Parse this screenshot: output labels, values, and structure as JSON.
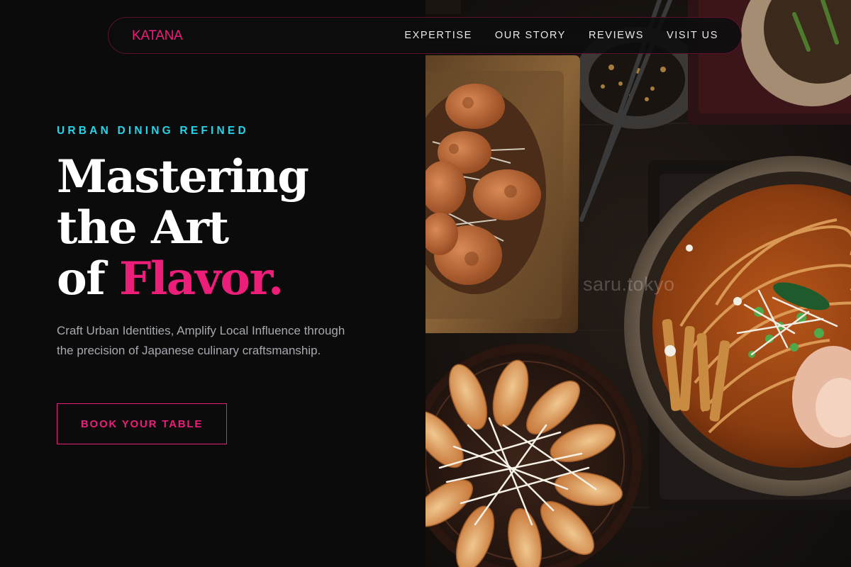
{
  "brand": {
    "name": "KATANA",
    "accent_color": "#ec1e79",
    "highlight_color": "#29d3e8"
  },
  "nav": {
    "links": [
      "EXPERTISE",
      "OUR STORY",
      "REVIEWS",
      "VISIT US"
    ]
  },
  "hero": {
    "eyebrow": "URBAN DINING REFINED",
    "headline_line1": "Mastering",
    "headline_line2": "the Art",
    "headline_line3_prefix": "of ",
    "headline_line3_accent": "Flavor.",
    "subtext": "Craft Urban Identities, Amplify Local Influence through the precision of Japanese culinary craftsmanship.",
    "cta_label": "BOOK YOUR TABLE"
  },
  "photo": {
    "watermark": "saru.tokyo"
  }
}
